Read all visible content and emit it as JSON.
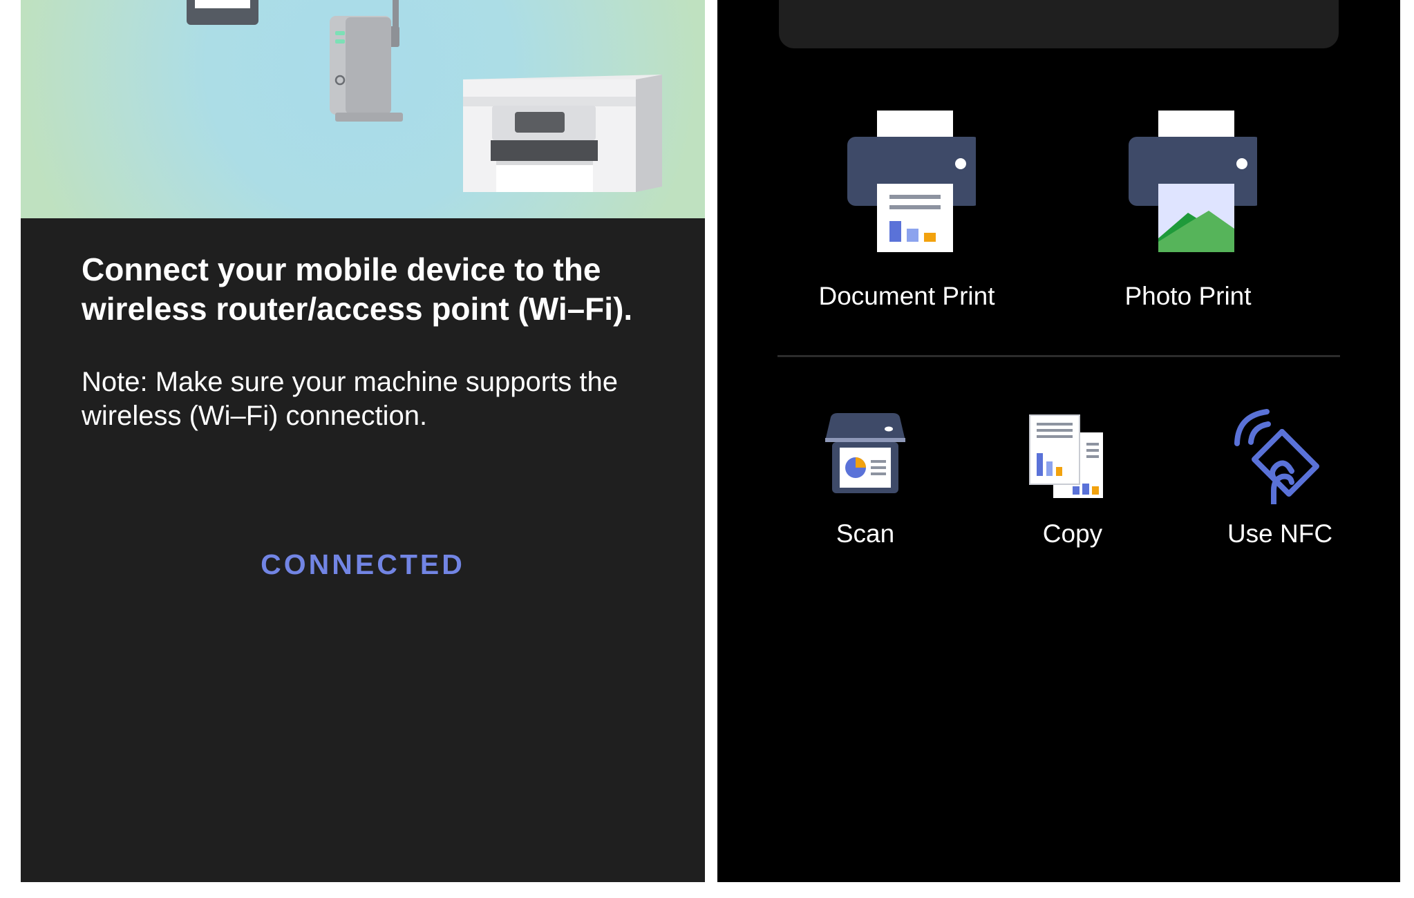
{
  "setup": {
    "heading": "Connect your mobile device to the wireless router/access point (Wi–Fi).",
    "note": "Note: Make sure your machine supports the wireless (Wi–Fi) connection.",
    "connected_label": "CONNECTED"
  },
  "functions": {
    "primary": [
      {
        "label": "Document Print",
        "icon": "document-print-icon"
      },
      {
        "label": "Photo Print",
        "icon": "photo-print-icon"
      }
    ],
    "secondary": [
      {
        "label": "Scan",
        "icon": "scan-icon"
      },
      {
        "label": "Copy",
        "icon": "copy-icon"
      },
      {
        "label": "Use NFC",
        "icon": "nfc-icon"
      }
    ]
  },
  "colors": {
    "accent": "#7285e4",
    "printer_body": "#3e4a68",
    "panel_dark": "#1f1f1f",
    "illustration_green": "#bfe1c0",
    "illustration_blue": "#a9dcea"
  }
}
